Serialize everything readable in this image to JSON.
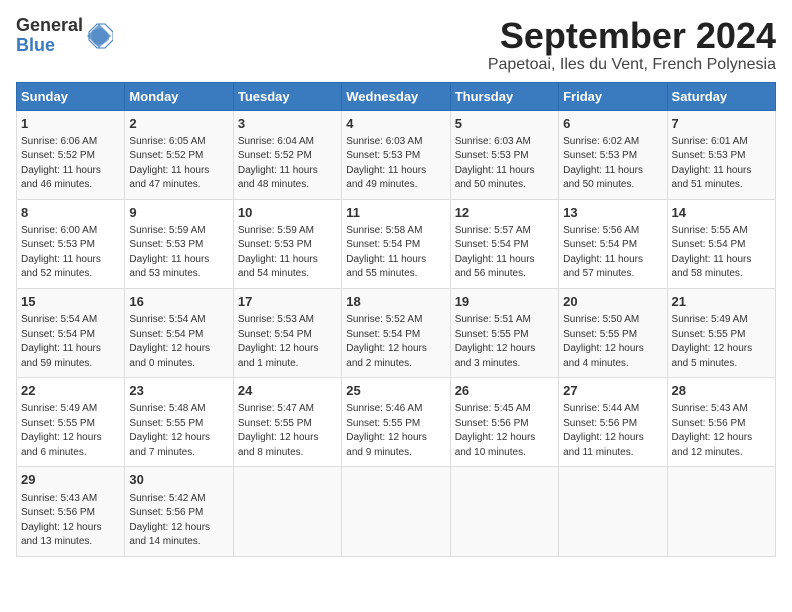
{
  "header": {
    "logo_line1": "General",
    "logo_line2": "Blue",
    "title": "September 2024",
    "subtitle": "Papetoai, Iles du Vent, French Polynesia"
  },
  "calendar": {
    "days_of_week": [
      "Sunday",
      "Monday",
      "Tuesday",
      "Wednesday",
      "Thursday",
      "Friday",
      "Saturday"
    ],
    "weeks": [
      [
        {
          "day": "1",
          "info": "Sunrise: 6:06 AM\nSunset: 5:52 PM\nDaylight: 11 hours\nand 46 minutes."
        },
        {
          "day": "2",
          "info": "Sunrise: 6:05 AM\nSunset: 5:52 PM\nDaylight: 11 hours\nand 47 minutes."
        },
        {
          "day": "3",
          "info": "Sunrise: 6:04 AM\nSunset: 5:52 PM\nDaylight: 11 hours\nand 48 minutes."
        },
        {
          "day": "4",
          "info": "Sunrise: 6:03 AM\nSunset: 5:53 PM\nDaylight: 11 hours\nand 49 minutes."
        },
        {
          "day": "5",
          "info": "Sunrise: 6:03 AM\nSunset: 5:53 PM\nDaylight: 11 hours\nand 50 minutes."
        },
        {
          "day": "6",
          "info": "Sunrise: 6:02 AM\nSunset: 5:53 PM\nDaylight: 11 hours\nand 50 minutes."
        },
        {
          "day": "7",
          "info": "Sunrise: 6:01 AM\nSunset: 5:53 PM\nDaylight: 11 hours\nand 51 minutes."
        }
      ],
      [
        {
          "day": "8",
          "info": "Sunrise: 6:00 AM\nSunset: 5:53 PM\nDaylight: 11 hours\nand 52 minutes."
        },
        {
          "day": "9",
          "info": "Sunrise: 5:59 AM\nSunset: 5:53 PM\nDaylight: 11 hours\nand 53 minutes."
        },
        {
          "day": "10",
          "info": "Sunrise: 5:59 AM\nSunset: 5:53 PM\nDaylight: 11 hours\nand 54 minutes."
        },
        {
          "day": "11",
          "info": "Sunrise: 5:58 AM\nSunset: 5:54 PM\nDaylight: 11 hours\nand 55 minutes."
        },
        {
          "day": "12",
          "info": "Sunrise: 5:57 AM\nSunset: 5:54 PM\nDaylight: 11 hours\nand 56 minutes."
        },
        {
          "day": "13",
          "info": "Sunrise: 5:56 AM\nSunset: 5:54 PM\nDaylight: 11 hours\nand 57 minutes."
        },
        {
          "day": "14",
          "info": "Sunrise: 5:55 AM\nSunset: 5:54 PM\nDaylight: 11 hours\nand 58 minutes."
        }
      ],
      [
        {
          "day": "15",
          "info": "Sunrise: 5:54 AM\nSunset: 5:54 PM\nDaylight: 11 hours\nand 59 minutes."
        },
        {
          "day": "16",
          "info": "Sunrise: 5:54 AM\nSunset: 5:54 PM\nDaylight: 12 hours\nand 0 minutes."
        },
        {
          "day": "17",
          "info": "Sunrise: 5:53 AM\nSunset: 5:54 PM\nDaylight: 12 hours\nand 1 minute."
        },
        {
          "day": "18",
          "info": "Sunrise: 5:52 AM\nSunset: 5:54 PM\nDaylight: 12 hours\nand 2 minutes."
        },
        {
          "day": "19",
          "info": "Sunrise: 5:51 AM\nSunset: 5:55 PM\nDaylight: 12 hours\nand 3 minutes."
        },
        {
          "day": "20",
          "info": "Sunrise: 5:50 AM\nSunset: 5:55 PM\nDaylight: 12 hours\nand 4 minutes."
        },
        {
          "day": "21",
          "info": "Sunrise: 5:49 AM\nSunset: 5:55 PM\nDaylight: 12 hours\nand 5 minutes."
        }
      ],
      [
        {
          "day": "22",
          "info": "Sunrise: 5:49 AM\nSunset: 5:55 PM\nDaylight: 12 hours\nand 6 minutes."
        },
        {
          "day": "23",
          "info": "Sunrise: 5:48 AM\nSunset: 5:55 PM\nDaylight: 12 hours\nand 7 minutes."
        },
        {
          "day": "24",
          "info": "Sunrise: 5:47 AM\nSunset: 5:55 PM\nDaylight: 12 hours\nand 8 minutes."
        },
        {
          "day": "25",
          "info": "Sunrise: 5:46 AM\nSunset: 5:55 PM\nDaylight: 12 hours\nand 9 minutes."
        },
        {
          "day": "26",
          "info": "Sunrise: 5:45 AM\nSunset: 5:56 PM\nDaylight: 12 hours\nand 10 minutes."
        },
        {
          "day": "27",
          "info": "Sunrise: 5:44 AM\nSunset: 5:56 PM\nDaylight: 12 hours\nand 11 minutes."
        },
        {
          "day": "28",
          "info": "Sunrise: 5:43 AM\nSunset: 5:56 PM\nDaylight: 12 hours\nand 12 minutes."
        }
      ],
      [
        {
          "day": "29",
          "info": "Sunrise: 5:43 AM\nSunset: 5:56 PM\nDaylight: 12 hours\nand 13 minutes."
        },
        {
          "day": "30",
          "info": "Sunrise: 5:42 AM\nSunset: 5:56 PM\nDaylight: 12 hours\nand 14 minutes."
        },
        {
          "day": "",
          "info": ""
        },
        {
          "day": "",
          "info": ""
        },
        {
          "day": "",
          "info": ""
        },
        {
          "day": "",
          "info": ""
        },
        {
          "day": "",
          "info": ""
        }
      ]
    ]
  }
}
